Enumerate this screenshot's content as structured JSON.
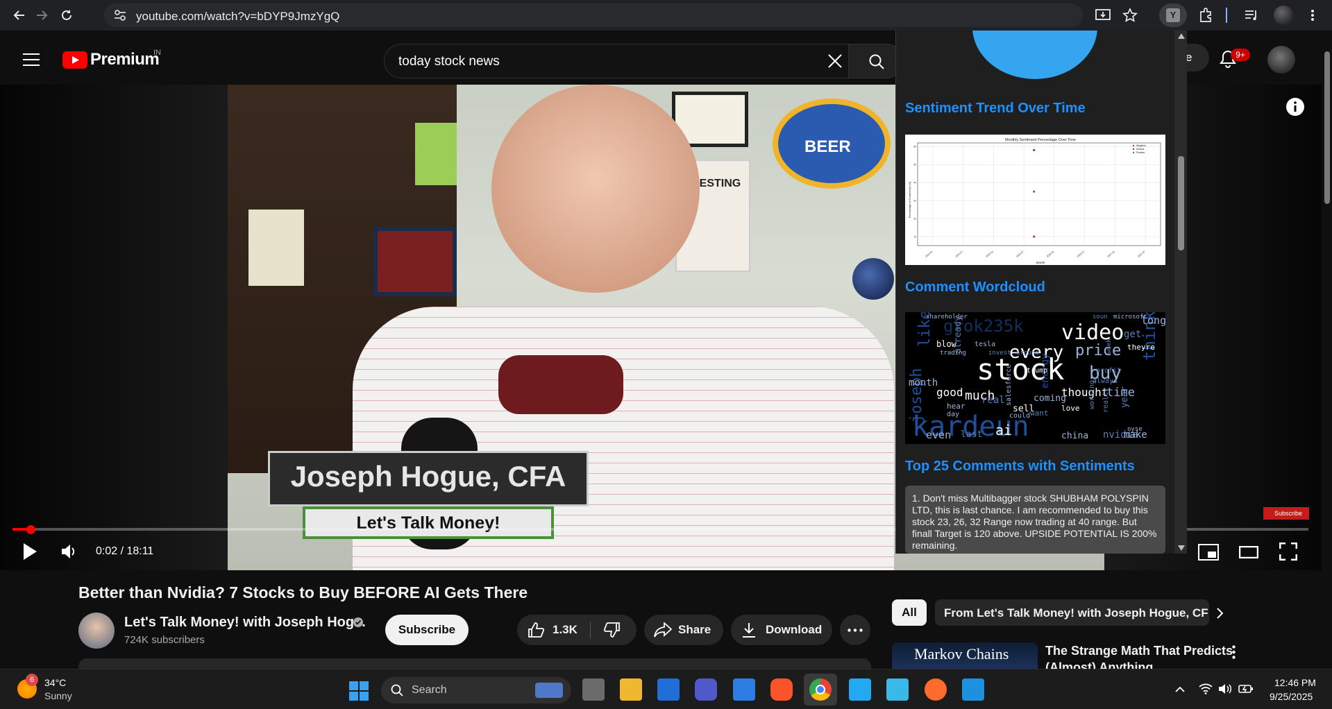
{
  "browser": {
    "url": "youtube.com/watch?v=bDYP9JmzYgQ",
    "extension_badge": "Y"
  },
  "youtube": {
    "logo_text": "Premium",
    "region": "IN",
    "search_query": "today stock news",
    "notifications_badge": "9+",
    "create_partial": "e"
  },
  "video_overlay": {
    "name_title": "Joseph Hogue, CFA",
    "channel_lower_third": "Let's Talk Money!",
    "time_current": "0:02",
    "time_total": "18:11",
    "time_display": "0:02 / 18:11",
    "subscribe_watermark": "Subscribe",
    "progress": 0.002
  },
  "popup": {
    "section_trend": "Sentiment Trend Over Time",
    "section_wordcloud": "Comment Wordcloud",
    "section_comments": "Top 25 Comments with Sentiments",
    "first_comment": "1. Don't miss Multibagger stock SHUBHAM POLYSPIN LTD, this is last chance. I am recommended to buy this stock 23, 26, 32 Range now trading at 40 range. But finall Target is 120 above. UPSIDE POTENTIAL IS 200% remaining.",
    "wordcloud_words": [
      "stock",
      "kardeun",
      "video",
      "grok235k",
      "every",
      "price",
      "buy",
      "think",
      "joseph",
      "like",
      "much",
      "good",
      "thought",
      "time",
      "ai",
      "even",
      "last",
      "china",
      "nvidia",
      "make",
      "sell",
      "love",
      "could",
      "day",
      "month",
      "year",
      "hear",
      "blow",
      "trading",
      "invest",
      "around",
      "tesla",
      "energy",
      "trump",
      "always",
      "profit",
      "shareholder",
      "microsoft",
      "soun",
      "long",
      "get",
      "theyre",
      "already",
      "real",
      "coming",
      "want",
      "salesforce",
      "working",
      "really",
      "nyse",
      "week"
    ]
  },
  "chart_data": {
    "type": "scatter",
    "title": "Monthly Sentiment Percentage Over Time",
    "xlabel": "Month",
    "ylabel": "Percentage of Comments (%)",
    "x": [
      "2024-01",
      "2024-07",
      "2025-01",
      "2025-07",
      "2026-01",
      "2026-07",
      "2027-01",
      "2027-07"
    ],
    "series": [
      {
        "name": "Negative",
        "color": "#e03030",
        "points": [
          {
            "x": "2025-09",
            "y": 10
          }
        ]
      },
      {
        "name": "Neutral",
        "color": "#555555",
        "points": [
          {
            "x": "2025-09",
            "y": 58
          }
        ]
      },
      {
        "name": "Positive",
        "color": "#2a9d2a",
        "points": [
          {
            "x": "2025-09",
            "y": 35
          }
        ]
      }
    ],
    "ylim": [
      5,
      62
    ],
    "grid": true,
    "legend": "top-right"
  },
  "below": {
    "title": "Better than Nvidia? 7 Stocks to Buy BEFORE AI Gets There",
    "channel": "Let's Talk Money! with Joseph Hog...",
    "subscribers": "724K subscribers",
    "subscribe": "Subscribe",
    "likes": "1.3K",
    "share": "Share",
    "download": "Download",
    "chip_all": "All",
    "chip_from": "From Let's Talk Money! with Joseph Hogue, CF",
    "rec_thumb_text": "Markov Chains",
    "rec_title": "The Strange Math That Predicts",
    "rec_title2": "(Almost) Anything"
  },
  "taskbar": {
    "weather_temp": "34°C",
    "weather_desc": "Sunny",
    "weather_badge": "6",
    "search_label": "Search",
    "time": "12:46 PM",
    "date": "9/25/2025"
  }
}
